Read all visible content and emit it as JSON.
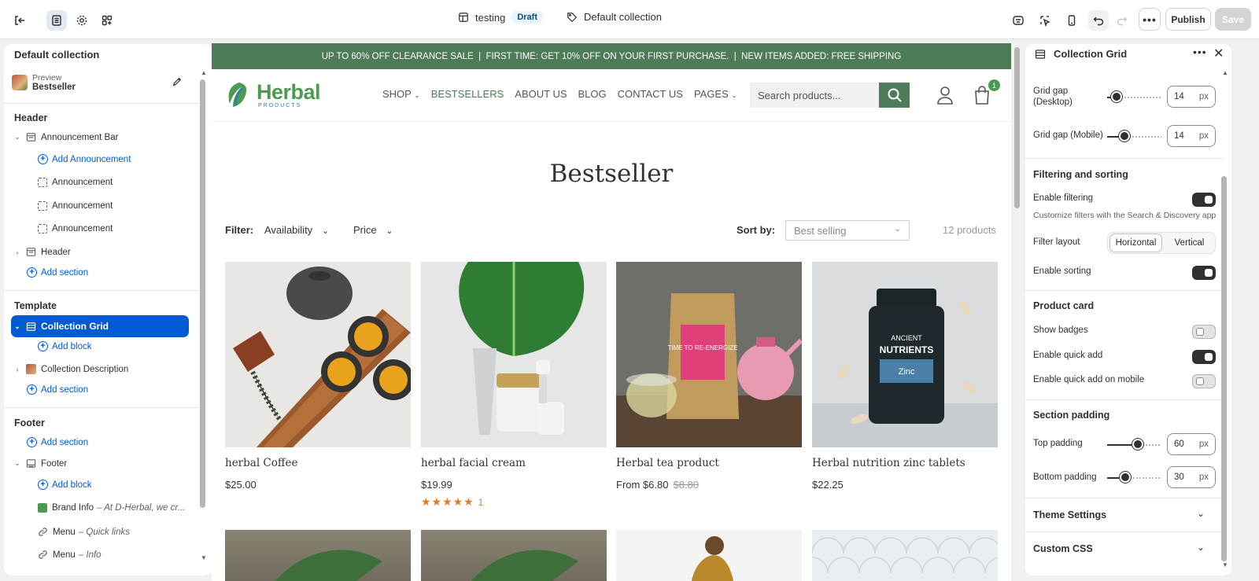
{
  "topbar": {
    "theme_name": "testing",
    "status_badge": "Draft",
    "template_name": "Default collection",
    "publish_label": "Publish",
    "save_label": "Save"
  },
  "left": {
    "title": "Default collection",
    "preview_label": "Preview",
    "preview_value": "Bestseller",
    "header_title": "Header",
    "announcement_bar": "Announcement Bar",
    "add_announcement": "Add Announcement",
    "announcements": [
      "Announcement",
      "Announcement",
      "Announcement"
    ],
    "header_item": "Header",
    "add_section": "Add section",
    "template_title": "Template",
    "collection_grid": "Collection Grid",
    "add_block": "Add block",
    "collection_description": "Collection Description",
    "footer_title": "Footer",
    "footer_item": "Footer",
    "brand_info": "Brand Info",
    "brand_info_sub": "– At D-Herbal, we cr...",
    "menu1": "Menu",
    "menu1_sub": "– Quick links",
    "menu2": "Menu",
    "menu2_sub": "– Info"
  },
  "store": {
    "announcement": "UP TO 60% OFF CLEARANCE SALE  |  FIRST TIME: GET 10% OFF ON YOUR FIRST PURCHASE.  |  NEW ITEMS ADDED: FREE SHIPPING",
    "logo_main": "Herbal",
    "logo_sub": "PRODUCTS",
    "nav": [
      "SHOP",
      "BESTSELLERS",
      "ABOUT US",
      "BLOG",
      "CONTACT US",
      "PAGES"
    ],
    "search_placeholder": "Search products...",
    "cart_count": "1",
    "page_title": "Bestseller",
    "filter_label": "Filter:",
    "filter_availability": "Availability",
    "filter_price": "Price",
    "sort_label": "Sort by:",
    "sort_value": "Best selling",
    "product_count": "12 products",
    "products": [
      {
        "name": "herbal Coffee",
        "price": "$25.00",
        "compare": "",
        "stars": "",
        "reviews": ""
      },
      {
        "name": "herbal facial cream",
        "price": "$19.99",
        "compare": "",
        "stars": "★★★★★",
        "reviews": "1"
      },
      {
        "name": "Herbal tea product",
        "price": "From $6.80",
        "compare": "$8.80",
        "stars": "",
        "reviews": ""
      },
      {
        "name": "Herbal nutrition zinc tablets",
        "price": "$22.25",
        "compare": "",
        "stars": "",
        "reviews": ""
      }
    ],
    "tea_bag_text": "TIME TO RE-ENERGIZE",
    "bottle_text_1": "ANCIENT",
    "bottle_text_2": "NUTRIENTS",
    "bottle_text_3": "Zinc"
  },
  "right": {
    "title": "Collection Grid",
    "grid_gap_desktop_label": "Grid gap (Desktop)",
    "grid_gap_desktop_value": "14",
    "grid_gap_mobile_label": "Grid gap (Mobile)",
    "grid_gap_mobile_value": "14",
    "unit": "px",
    "filtering_title": "Filtering and sorting",
    "enable_filtering": "Enable filtering",
    "filtering_help": "Customize filters with the Search & Discovery app",
    "filter_layout": "Filter layout",
    "layout_options": [
      "Horizontal",
      "Vertical"
    ],
    "enable_sorting": "Enable sorting",
    "product_card_title": "Product card",
    "show_badges": "Show badges",
    "enable_quick_add": "Enable quick add",
    "enable_quick_add_mobile": "Enable quick add on mobile",
    "padding_title": "Section padding",
    "top_padding": "Top padding",
    "top_padding_value": "60",
    "bottom_padding": "Bottom padding",
    "bottom_padding_value": "30",
    "theme_settings": "Theme Settings",
    "custom_css": "Custom CSS"
  }
}
